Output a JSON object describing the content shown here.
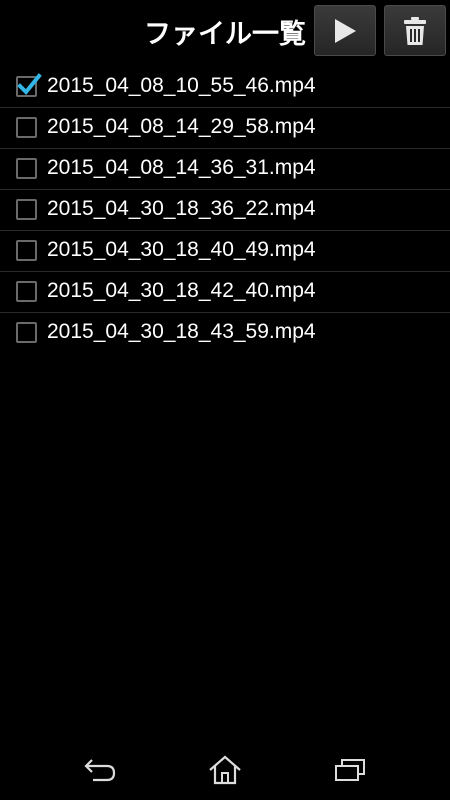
{
  "header": {
    "title": "ファイル一覧",
    "play_icon": "play-icon",
    "trash_icon": "trash-icon"
  },
  "files": [
    {
      "name": "2015_04_08_10_55_46.mp4",
      "checked": true
    },
    {
      "name": "2015_04_08_14_29_58.mp4",
      "checked": false
    },
    {
      "name": "2015_04_08_14_36_31.mp4",
      "checked": false
    },
    {
      "name": "2015_04_30_18_36_22.mp4",
      "checked": false
    },
    {
      "name": "2015_04_30_18_40_49.mp4",
      "checked": false
    },
    {
      "name": "2015_04_30_18_42_40.mp4",
      "checked": false
    },
    {
      "name": "2015_04_30_18_43_59.mp4",
      "checked": false
    }
  ],
  "navbar": {
    "back_icon": "back-icon",
    "home_icon": "home-icon",
    "recent_icon": "recent-apps-icon"
  },
  "colors": {
    "background": "#000000",
    "check_accent": "#33b5e5",
    "text": "#ffffff"
  }
}
